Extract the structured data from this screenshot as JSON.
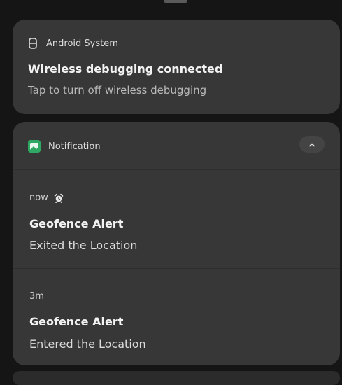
{
  "system_notification": {
    "app_name": "Android System",
    "app_icon": "android-system-icon",
    "title": "Wireless debugging connected",
    "text": "Tap to turn off wireless debugging"
  },
  "notification_group": {
    "app_name": "Notification",
    "app_icon": "notification-app-icon",
    "app_icon_color": "#2ea862",
    "collapse_icon": "chevron-up-icon",
    "items": [
      {
        "time": "now",
        "status_icon": "alarm-icon",
        "title": "Geofence Alert",
        "text": "Exited the Location"
      },
      {
        "time": "3m",
        "title": "Geofence Alert",
        "text": "Entered the Location"
      }
    ]
  },
  "colors": {
    "background": "#151515",
    "card": "#373737",
    "accent": "#2ea862"
  }
}
